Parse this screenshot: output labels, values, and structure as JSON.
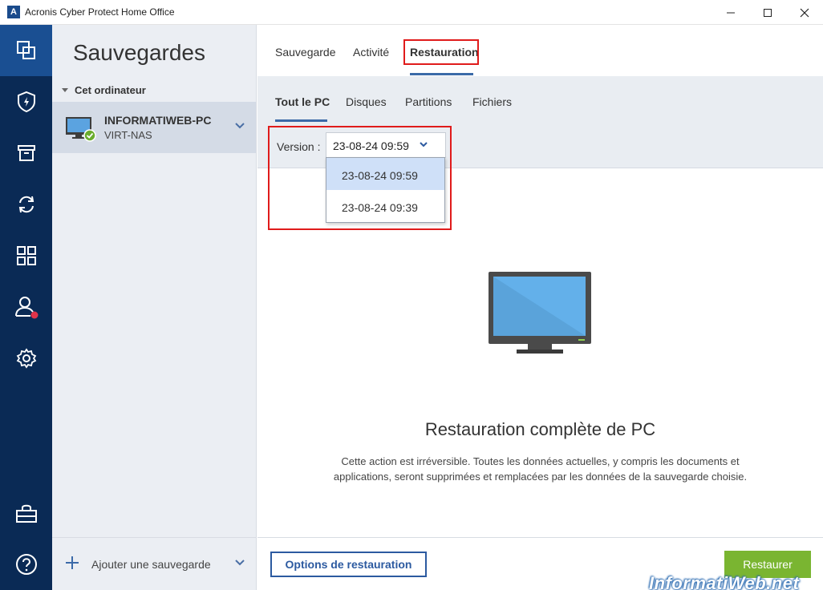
{
  "window": {
    "title": "Acronis Cyber Protect Home Office",
    "logo_letter": "A"
  },
  "rail": {
    "items": [
      "backup-icon",
      "protection-icon",
      "archive-icon",
      "sync-icon",
      "tools-icon",
      "account-icon",
      "settings-icon",
      "store-icon",
      "help-icon"
    ],
    "active": "backup-icon",
    "colors": {
      "background": "#0a2a55",
      "active": "#1a4f92",
      "notification": "#e0344a"
    }
  },
  "sidebar": {
    "title": "Sauvegardes",
    "group_label": "Cet ordinateur",
    "backup": {
      "name": "INFORMATIWEB-PC",
      "destination": "VIRT-NAS",
      "status": "ok"
    },
    "add_label": "Ajouter une sauvegarde"
  },
  "tabs": [
    {
      "label": "Sauvegarde"
    },
    {
      "label": "Activité"
    },
    {
      "label": "Restauration",
      "active": true
    }
  ],
  "subtabs": [
    {
      "label": "Tout le PC",
      "active": true
    },
    {
      "label": "Disques"
    },
    {
      "label": "Partitions"
    },
    {
      "label": "Fichiers"
    }
  ],
  "version": {
    "label": "Version :",
    "selected": "23-08-24 09:59",
    "options": [
      "23-08-24 09:59",
      "23-08-24 09:39"
    ]
  },
  "content": {
    "heading": "Restauration complète de PC",
    "description_line1": "Cette action est irréversible. Toutes les données actuelles, y compris les documents et",
    "description_line2": "applications, seront supprimées et remplacées par les données de la sauvegarde choisie."
  },
  "footer": {
    "options_label": "Options de restauration",
    "restore_label": "Restaurer",
    "watermark": "InformatiWeb.net"
  },
  "colors": {
    "accent": "#2c5aa0",
    "restore_button": "#7ab531",
    "highlight_box": "#e01b1b"
  }
}
